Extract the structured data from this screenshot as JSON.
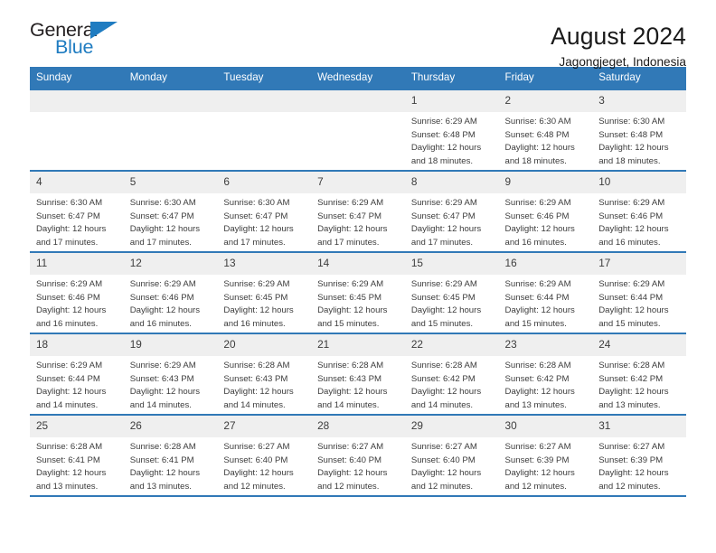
{
  "brand": {
    "name_top": "General",
    "name_bottom": "Blue",
    "accent_color": "#1f7cc1",
    "triangle_icon": "triangle-icon"
  },
  "header": {
    "title": "August 2024",
    "subtitle": "Jagongjeget, Indonesia"
  },
  "calendar": {
    "header_bg": "#3179b7",
    "daynum_bg": "#efefef",
    "weekdays": [
      "Sunday",
      "Monday",
      "Tuesday",
      "Wednesday",
      "Thursday",
      "Friday",
      "Saturday"
    ],
    "weeks": [
      [
        {
          "day": "",
          "lines": []
        },
        {
          "day": "",
          "lines": []
        },
        {
          "day": "",
          "lines": []
        },
        {
          "day": "",
          "lines": []
        },
        {
          "day": "1",
          "lines": [
            "Sunrise: 6:29 AM",
            "Sunset: 6:48 PM",
            "Daylight: 12 hours",
            "and 18 minutes."
          ]
        },
        {
          "day": "2",
          "lines": [
            "Sunrise: 6:30 AM",
            "Sunset: 6:48 PM",
            "Daylight: 12 hours",
            "and 18 minutes."
          ]
        },
        {
          "day": "3",
          "lines": [
            "Sunrise: 6:30 AM",
            "Sunset: 6:48 PM",
            "Daylight: 12 hours",
            "and 18 minutes."
          ]
        }
      ],
      [
        {
          "day": "4",
          "lines": [
            "Sunrise: 6:30 AM",
            "Sunset: 6:47 PM",
            "Daylight: 12 hours",
            "and 17 minutes."
          ]
        },
        {
          "day": "5",
          "lines": [
            "Sunrise: 6:30 AM",
            "Sunset: 6:47 PM",
            "Daylight: 12 hours",
            "and 17 minutes."
          ]
        },
        {
          "day": "6",
          "lines": [
            "Sunrise: 6:30 AM",
            "Sunset: 6:47 PM",
            "Daylight: 12 hours",
            "and 17 minutes."
          ]
        },
        {
          "day": "7",
          "lines": [
            "Sunrise: 6:29 AM",
            "Sunset: 6:47 PM",
            "Daylight: 12 hours",
            "and 17 minutes."
          ]
        },
        {
          "day": "8",
          "lines": [
            "Sunrise: 6:29 AM",
            "Sunset: 6:47 PM",
            "Daylight: 12 hours",
            "and 17 minutes."
          ]
        },
        {
          "day": "9",
          "lines": [
            "Sunrise: 6:29 AM",
            "Sunset: 6:46 PM",
            "Daylight: 12 hours",
            "and 16 minutes."
          ]
        },
        {
          "day": "10",
          "lines": [
            "Sunrise: 6:29 AM",
            "Sunset: 6:46 PM",
            "Daylight: 12 hours",
            "and 16 minutes."
          ]
        }
      ],
      [
        {
          "day": "11",
          "lines": [
            "Sunrise: 6:29 AM",
            "Sunset: 6:46 PM",
            "Daylight: 12 hours",
            "and 16 minutes."
          ]
        },
        {
          "day": "12",
          "lines": [
            "Sunrise: 6:29 AM",
            "Sunset: 6:46 PM",
            "Daylight: 12 hours",
            "and 16 minutes."
          ]
        },
        {
          "day": "13",
          "lines": [
            "Sunrise: 6:29 AM",
            "Sunset: 6:45 PM",
            "Daylight: 12 hours",
            "and 16 minutes."
          ]
        },
        {
          "day": "14",
          "lines": [
            "Sunrise: 6:29 AM",
            "Sunset: 6:45 PM",
            "Daylight: 12 hours",
            "and 15 minutes."
          ]
        },
        {
          "day": "15",
          "lines": [
            "Sunrise: 6:29 AM",
            "Sunset: 6:45 PM",
            "Daylight: 12 hours",
            "and 15 minutes."
          ]
        },
        {
          "day": "16",
          "lines": [
            "Sunrise: 6:29 AM",
            "Sunset: 6:44 PM",
            "Daylight: 12 hours",
            "and 15 minutes."
          ]
        },
        {
          "day": "17",
          "lines": [
            "Sunrise: 6:29 AM",
            "Sunset: 6:44 PM",
            "Daylight: 12 hours",
            "and 15 minutes."
          ]
        }
      ],
      [
        {
          "day": "18",
          "lines": [
            "Sunrise: 6:29 AM",
            "Sunset: 6:44 PM",
            "Daylight: 12 hours",
            "and 14 minutes."
          ]
        },
        {
          "day": "19",
          "lines": [
            "Sunrise: 6:29 AM",
            "Sunset: 6:43 PM",
            "Daylight: 12 hours",
            "and 14 minutes."
          ]
        },
        {
          "day": "20",
          "lines": [
            "Sunrise: 6:28 AM",
            "Sunset: 6:43 PM",
            "Daylight: 12 hours",
            "and 14 minutes."
          ]
        },
        {
          "day": "21",
          "lines": [
            "Sunrise: 6:28 AM",
            "Sunset: 6:43 PM",
            "Daylight: 12 hours",
            "and 14 minutes."
          ]
        },
        {
          "day": "22",
          "lines": [
            "Sunrise: 6:28 AM",
            "Sunset: 6:42 PM",
            "Daylight: 12 hours",
            "and 14 minutes."
          ]
        },
        {
          "day": "23",
          "lines": [
            "Sunrise: 6:28 AM",
            "Sunset: 6:42 PM",
            "Daylight: 12 hours",
            "and 13 minutes."
          ]
        },
        {
          "day": "24",
          "lines": [
            "Sunrise: 6:28 AM",
            "Sunset: 6:42 PM",
            "Daylight: 12 hours",
            "and 13 minutes."
          ]
        }
      ],
      [
        {
          "day": "25",
          "lines": [
            "Sunrise: 6:28 AM",
            "Sunset: 6:41 PM",
            "Daylight: 12 hours",
            "and 13 minutes."
          ]
        },
        {
          "day": "26",
          "lines": [
            "Sunrise: 6:28 AM",
            "Sunset: 6:41 PM",
            "Daylight: 12 hours",
            "and 13 minutes."
          ]
        },
        {
          "day": "27",
          "lines": [
            "Sunrise: 6:27 AM",
            "Sunset: 6:40 PM",
            "Daylight: 12 hours",
            "and 12 minutes."
          ]
        },
        {
          "day": "28",
          "lines": [
            "Sunrise: 6:27 AM",
            "Sunset: 6:40 PM",
            "Daylight: 12 hours",
            "and 12 minutes."
          ]
        },
        {
          "day": "29",
          "lines": [
            "Sunrise: 6:27 AM",
            "Sunset: 6:40 PM",
            "Daylight: 12 hours",
            "and 12 minutes."
          ]
        },
        {
          "day": "30",
          "lines": [
            "Sunrise: 6:27 AM",
            "Sunset: 6:39 PM",
            "Daylight: 12 hours",
            "and 12 minutes."
          ]
        },
        {
          "day": "31",
          "lines": [
            "Sunrise: 6:27 AM",
            "Sunset: 6:39 PM",
            "Daylight: 12 hours",
            "and 12 minutes."
          ]
        }
      ]
    ]
  }
}
